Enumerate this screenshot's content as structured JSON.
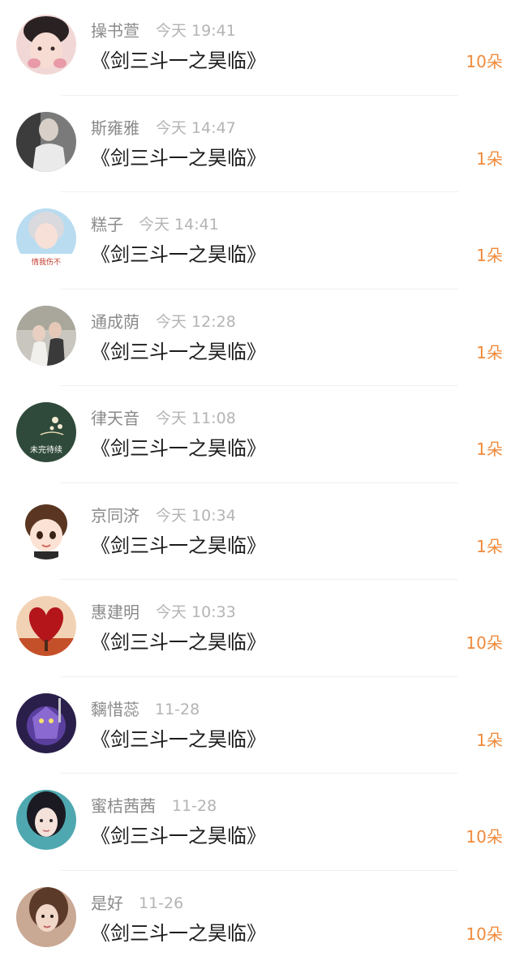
{
  "gift_list": {
    "items": [
      {
        "name": "操书萱",
        "time": "今天 19:41",
        "title": "《剑三斗一之昊临》",
        "count": "10朵"
      },
      {
        "name": "斯雍雅",
        "time": "今天 14:47",
        "title": "《剑三斗一之昊临》",
        "count": "1朵"
      },
      {
        "name": "糕子",
        "time": "今天 14:41",
        "title": "《剑三斗一之昊临》",
        "count": "1朵",
        "avatar_caption": "情我伤不"
      },
      {
        "name": "通成荫",
        "time": "今天 12:28",
        "title": "《剑三斗一之昊临》",
        "count": "1朵"
      },
      {
        "name": "律天音",
        "time": "今天 11:08",
        "title": "《剑三斗一之昊临》",
        "count": "1朵",
        "avatar_caption": "未完待续"
      },
      {
        "name": "京同济",
        "time": "今天 10:34",
        "title": "《剑三斗一之昊临》",
        "count": "1朵"
      },
      {
        "name": "惠建明",
        "time": "今天 10:33",
        "title": "《剑三斗一之昊临》",
        "count": "10朵"
      },
      {
        "name": "黐惜蕊",
        "time": "11-28",
        "title": "《剑三斗一之昊临》",
        "count": "1朵"
      },
      {
        "name": "蜜桔茜茜",
        "time": "11-28",
        "title": "《剑三斗一之昊临》",
        "count": "10朵"
      },
      {
        "name": "是好",
        "time": "11-26",
        "title": "《剑三斗一之昊临》",
        "count": "10朵"
      }
    ]
  },
  "colors": {
    "count_accent": "#f08a3c",
    "name_text": "#8a8a8a",
    "time_text": "#b4b4b4",
    "title_text": "#1c1c1c"
  }
}
